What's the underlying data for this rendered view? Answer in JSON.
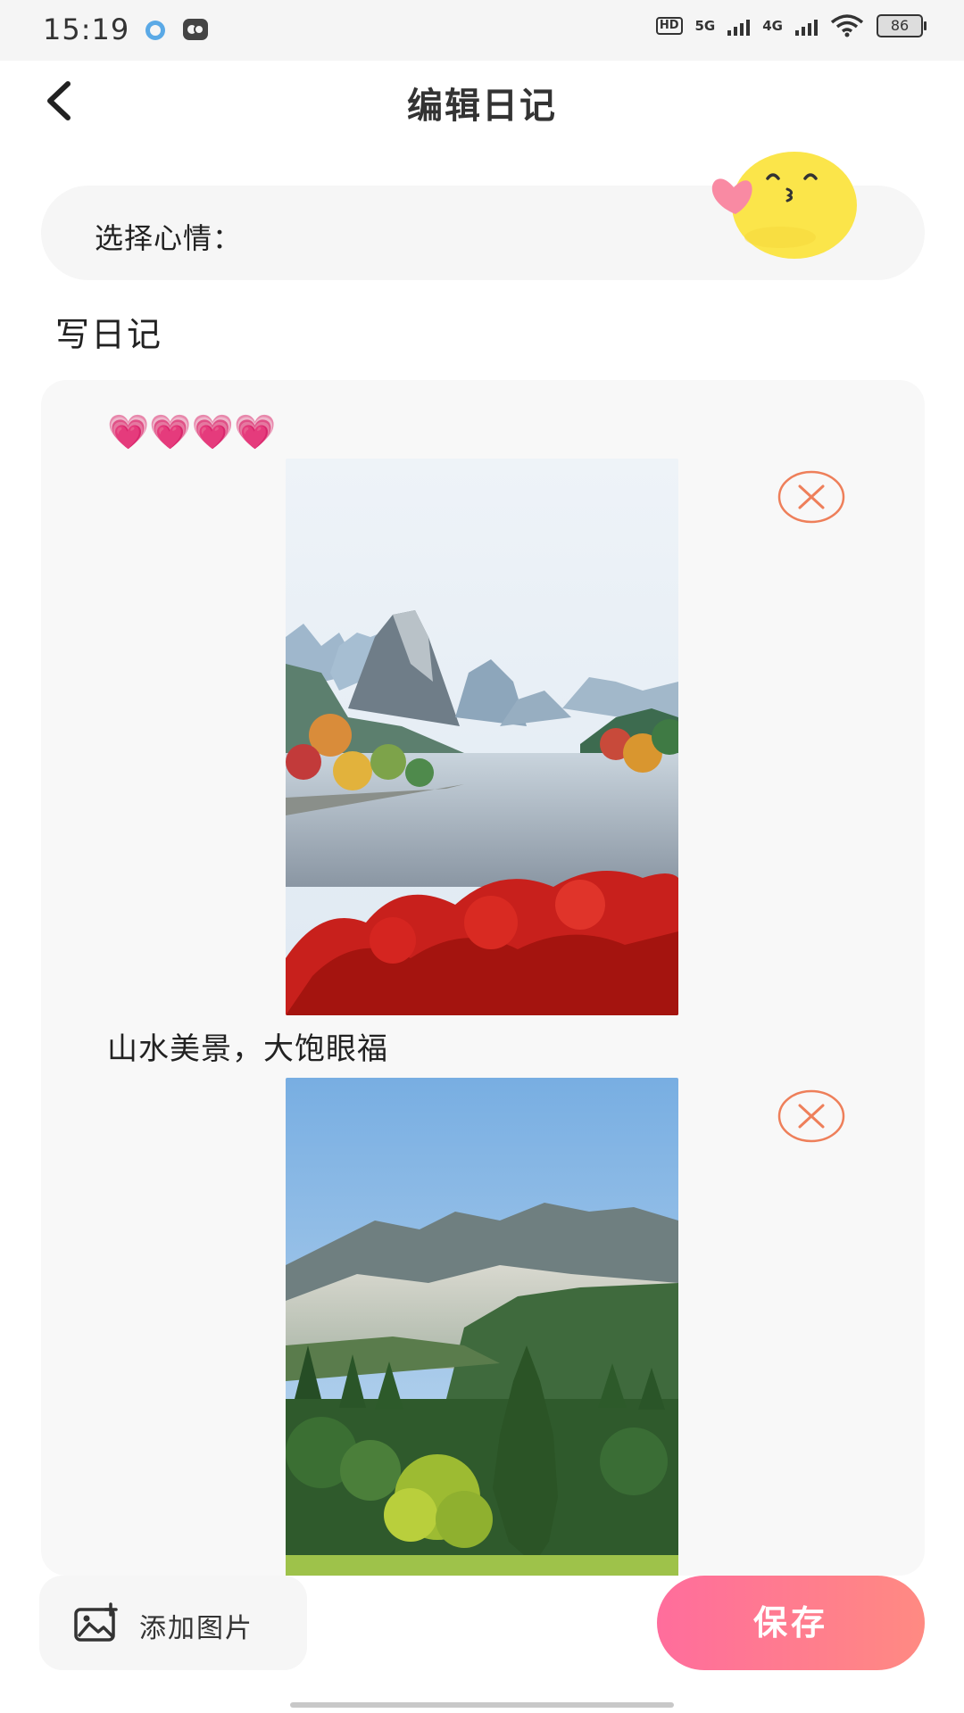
{
  "status_bar": {
    "time": "15:19",
    "sig1_label": "5G",
    "sig2_label": "4G",
    "hd_label": "HD",
    "battery": "86"
  },
  "header": {
    "title": "编辑日记",
    "back_icon": "chevron-left-icon"
  },
  "mood": {
    "label": "选择心情：",
    "emoji_icon": "kissing-face-heart-icon"
  },
  "section": {
    "title": "写日记"
  },
  "editor": {
    "hearts": "💗💗💗💗",
    "caption": "山水美景，大饱眼福",
    "photos": [
      {
        "subject": "karst-river-autumn-photo"
      },
      {
        "subject": "misty-forest-mountains-photo"
      }
    ],
    "remove_icon": "close-circle-icon"
  },
  "bottom": {
    "add_image_label": "添加图片",
    "save_label": "保存"
  },
  "colors": {
    "accent_start": "#ff6d9c",
    "accent_end": "#ff8a82",
    "remove_icon_color": "#ee7f5a",
    "heart_color": "#e8508a"
  }
}
